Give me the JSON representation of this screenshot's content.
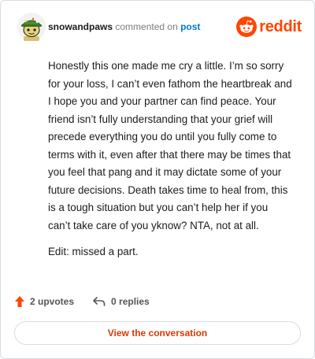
{
  "comment": {
    "username": "snowandpaws",
    "action_text": "commented on",
    "target_link": "post",
    "brand": "reddit",
    "paragraphs": [
      "Honestly this one made me cry a little. I’m so sorry for your loss, I can’t even fathom the heartbreak and I hope you and your partner can find peace. Your friend isn’t fully understanding that your grief will precede everything you do until you fully come to terms with it, even after that there may be times that you feel that pang and it may dictate some of your future decisions. Death takes time to heal from, this is a tough situation but you can’t help her if you can’t take care of you yknow? NTA, not at all.",
      "Edit: missed a part."
    ],
    "upvotes_label": "2 upvotes",
    "replies_label": "0 replies",
    "cta_label": "View the conversation"
  },
  "colors": {
    "brand_orange": "#ff4500",
    "link_blue": "#0079d3",
    "cta_text": "#d93a00",
    "upvote_arrow": "#ff4500"
  },
  "icons": {
    "avatar": "snoo-avatar-green-hat",
    "brand": "reddit-snoo-icon",
    "upvote": "upvote-arrow-icon",
    "reply": "reply-arrow-icon"
  }
}
